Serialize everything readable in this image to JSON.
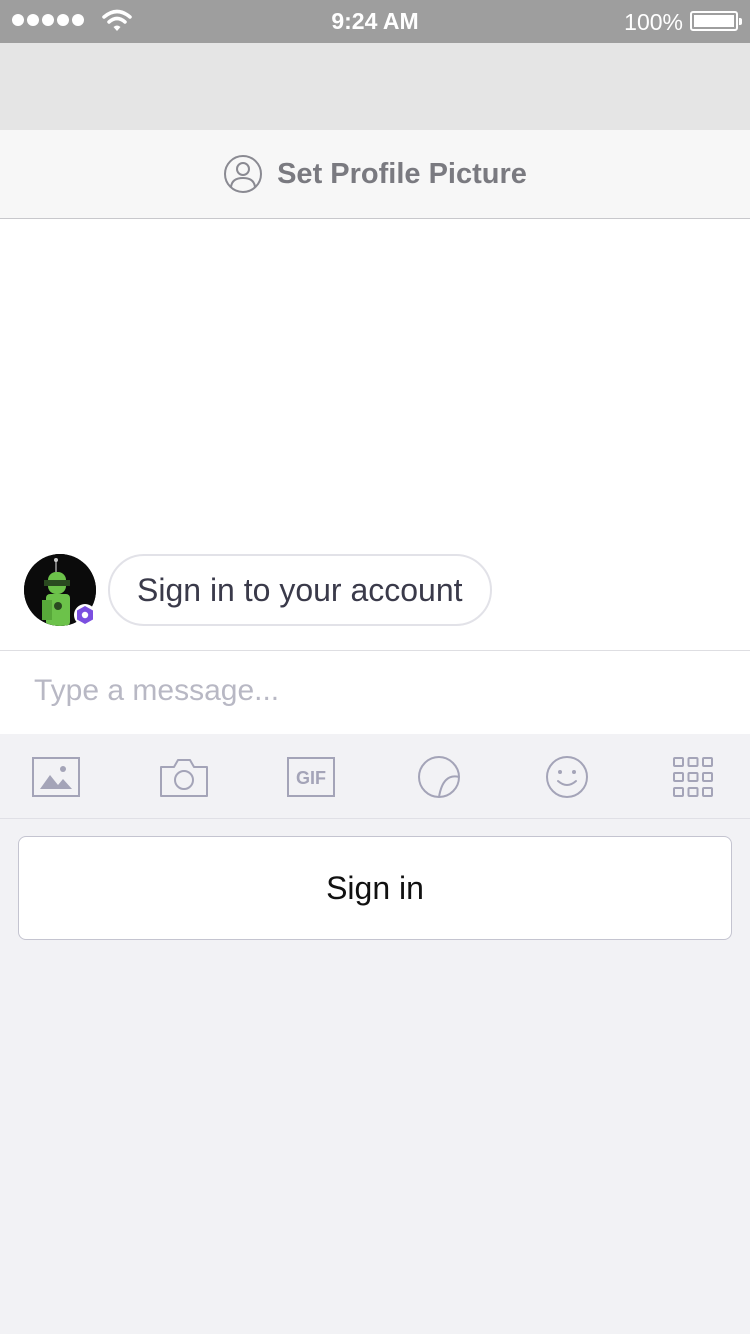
{
  "status_bar": {
    "time": "9:24 AM",
    "battery": "100%",
    "signal_icon": "signal-dots-icon",
    "wifi_icon": "wifi-icon"
  },
  "profile_banner": {
    "label": "Set Profile Picture",
    "icon": "person-circle-icon"
  },
  "chat": {
    "messages": [
      {
        "text": "Sign in to your account",
        "avatar": "robot-avatar"
      }
    ]
  },
  "composer": {
    "placeholder": "Type a message...",
    "value": ""
  },
  "toolbar": {
    "items": [
      {
        "icon": "image-icon"
      },
      {
        "icon": "camera-icon"
      },
      {
        "icon": "gif-icon",
        "label": "GIF"
      },
      {
        "icon": "sticker-icon"
      },
      {
        "icon": "emoji-icon"
      },
      {
        "icon": "grid-icon"
      }
    ]
  },
  "signin": {
    "label": "Sign in"
  },
  "colors": {
    "status_bar": "#9e9e9e",
    "icon_gray": "#a4a4b8",
    "badge_purple": "#7b4fe0",
    "avatar_green": "#6cc24a"
  }
}
